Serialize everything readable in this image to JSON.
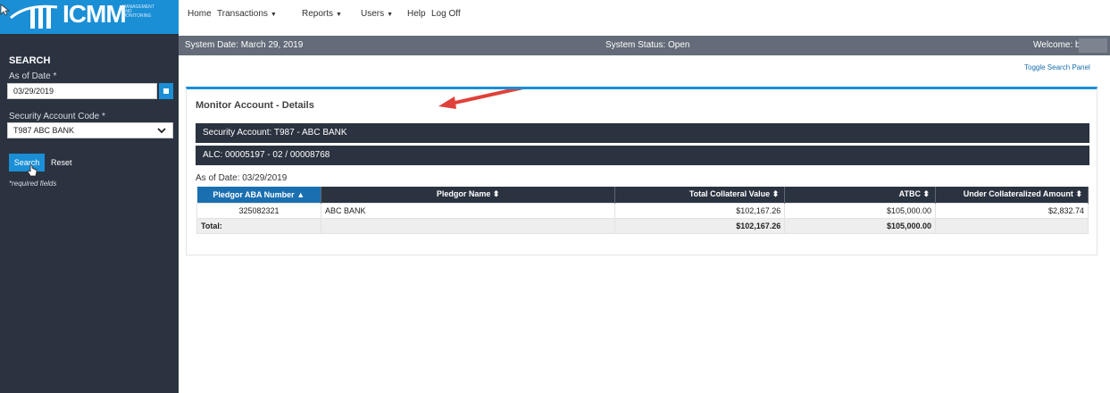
{
  "logo": {
    "text": "ICMM",
    "subtitle": "MANAGEMENT AND MONITORING"
  },
  "nav": {
    "items": [
      {
        "label": "Home",
        "dropdown": false
      },
      {
        "label": "Transactions",
        "dropdown": true
      },
      {
        "label": "Reports",
        "dropdown": true
      },
      {
        "label": "Users",
        "dropdown": true
      },
      {
        "label": "Help",
        "dropdown": false
      },
      {
        "label": "Log Off",
        "dropdown": false
      }
    ]
  },
  "status": {
    "system_date": "System Date: March 29, 2019",
    "system_status": "System Status: Open",
    "welcome": "Welcome: b"
  },
  "sidebar": {
    "title": "SEARCH",
    "asof_label": "As of Date *",
    "asof_value": "03/29/2019",
    "security_label": "Security Account Code *",
    "security_value": "T987 ABC BANK",
    "search_button": "Search",
    "reset_link": "Reset",
    "required_note": "*required fields"
  },
  "toggle_link": "Toggle Search Panel",
  "panel": {
    "title": "Monitor Account - Details",
    "security_account": "Security Account: T987 - ABC BANK",
    "alc": "ALC: 00005197 - 02 / 00008768",
    "asof": "As of Date: 03/29/2019"
  },
  "table": {
    "headers": [
      {
        "label": "Pledgor ABA Number",
        "sort": "▲"
      },
      {
        "label": "Pledgor Name",
        "sort": "⬍"
      },
      {
        "label": "Total Collateral Value",
        "sort": "⬍"
      },
      {
        "label": "ATBC",
        "sort": "⬍"
      },
      {
        "label": "Under Collateralized Amount",
        "sort": "⬍"
      }
    ],
    "rows": [
      [
        "325082321",
        "ABC BANK",
        "$102,167.26",
        "$105,000.00",
        "$2,832.74"
      ]
    ],
    "total": [
      "Total:",
      "",
      "$102,167.26",
      "$105,000.00",
      ""
    ]
  },
  "colors": {
    "brand_blue": "#1a8fd6",
    "sidebar_bg": "#2b3340",
    "statusbar_bg": "#636c78",
    "annotation_arrow": "#e0413a"
  }
}
